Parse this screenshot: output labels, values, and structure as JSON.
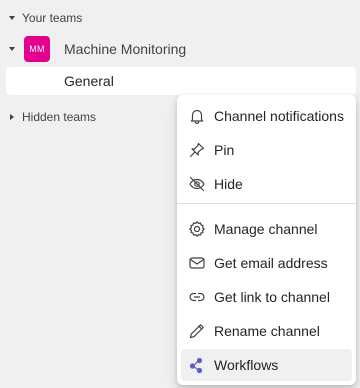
{
  "sidebar": {
    "your_teams_label": "Your teams",
    "team": {
      "avatar_initials": "MM",
      "avatar_color": "#e3008c",
      "name": "Machine Monitoring",
      "channels": [
        {
          "label": "General"
        }
      ]
    },
    "hidden_teams_label": "Hidden teams"
  },
  "context_menu": {
    "items": [
      {
        "label": "Channel notifications",
        "icon": "bell-icon"
      },
      {
        "label": "Pin",
        "icon": "pin-icon"
      },
      {
        "label": "Hide",
        "icon": "eye-off-icon"
      },
      {
        "label": "Manage channel",
        "icon": "gear-icon"
      },
      {
        "label": "Get email address",
        "icon": "mail-icon"
      },
      {
        "label": "Get link to channel",
        "icon": "link-icon"
      },
      {
        "label": "Rename channel",
        "icon": "pencil-icon"
      },
      {
        "label": "Workflows",
        "icon": "workflows-icon",
        "highlighted": true,
        "icon_color": "#5b5fc7"
      }
    ]
  }
}
